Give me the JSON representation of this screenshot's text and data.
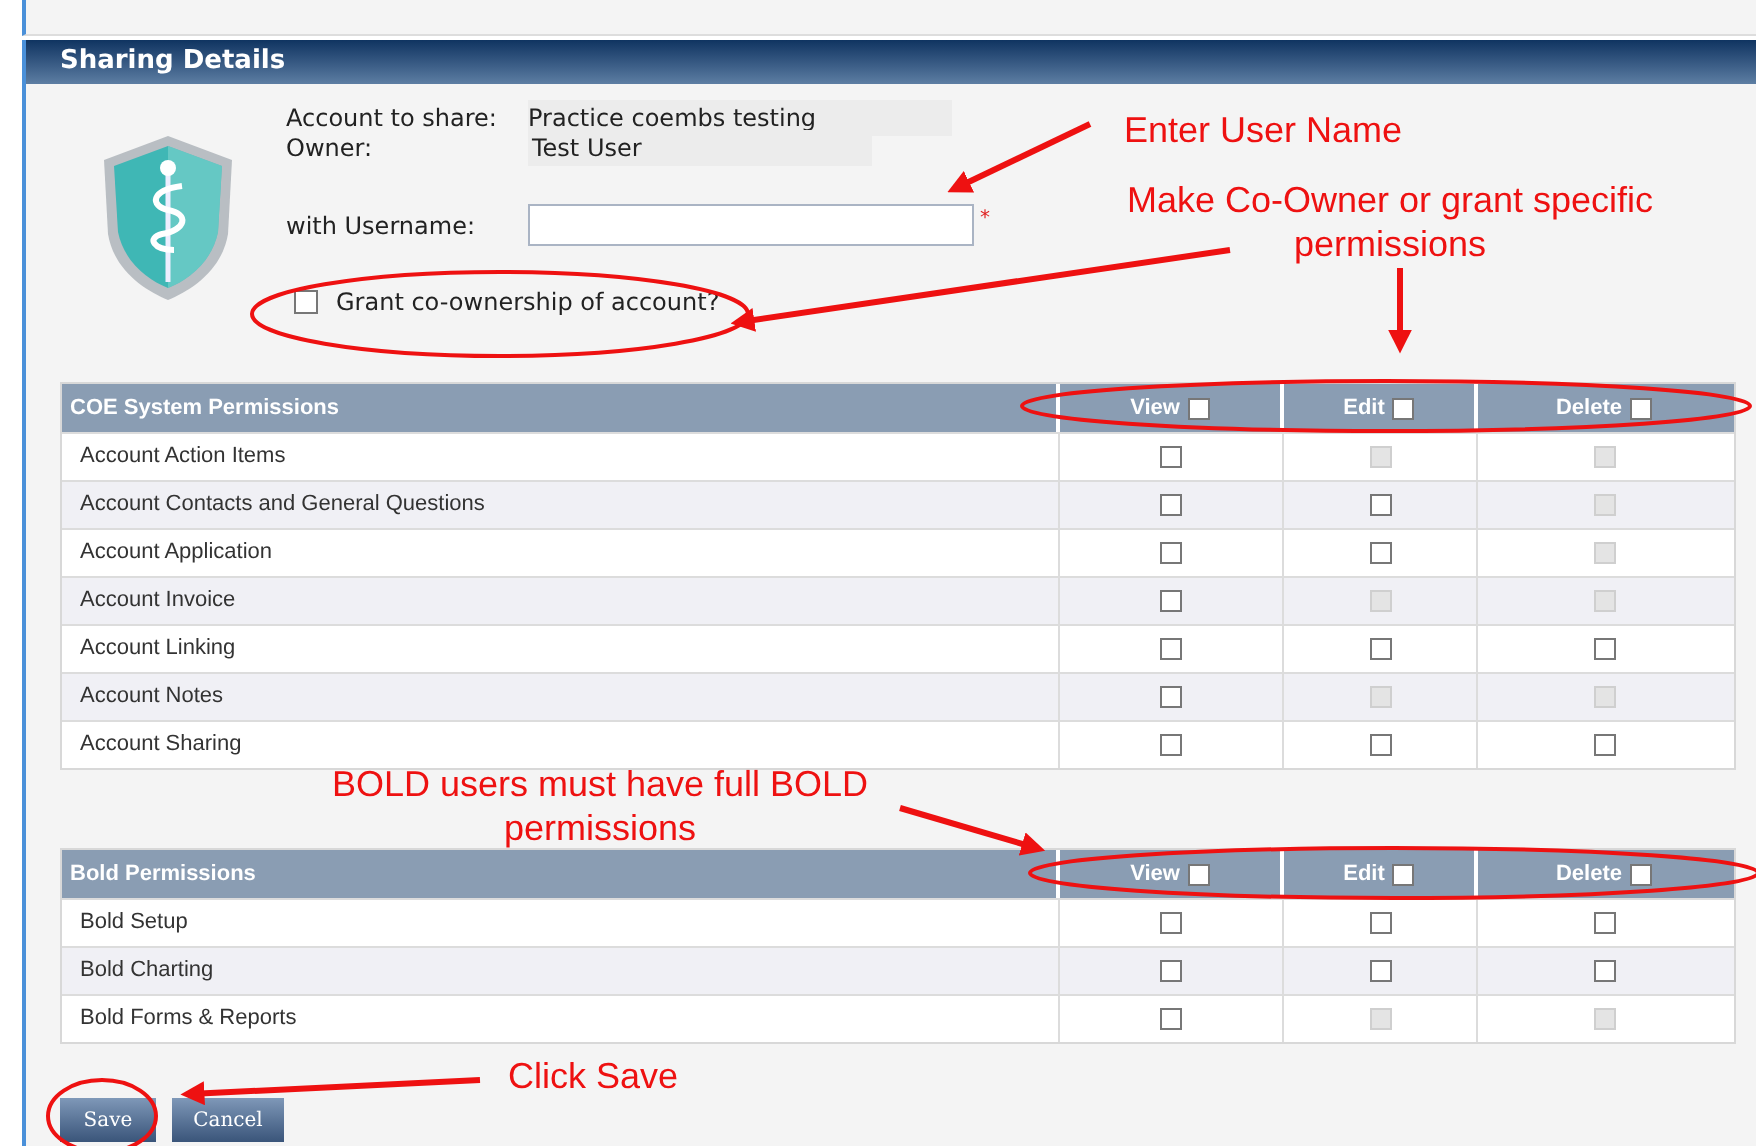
{
  "panel": {
    "title": "Sharing Details"
  },
  "account": {
    "fields": [
      {
        "label": "Account to share:",
        "value": "Practice coembs testing"
      },
      {
        "label": "Owner:",
        "value": "Test User"
      }
    ],
    "username": {
      "label": "with Username:",
      "required_mark": "*"
    },
    "co_ownership": {
      "label": "Grant co-ownership of account?",
      "checked": false
    }
  },
  "tables": [
    {
      "title": "COE System Permissions",
      "columns": [
        {
          "label": "View",
          "checked": false
        },
        {
          "label": "Edit",
          "checked": false
        },
        {
          "label": "Delete",
          "checked": false
        }
      ],
      "rows": [
        {
          "name": "Account Action Items",
          "permissions": [
            {
              "checked": false,
              "disabled": false
            },
            {
              "checked": false,
              "disabled": true
            },
            {
              "checked": false,
              "disabled": true
            }
          ]
        },
        {
          "name": "Account Contacts and General Questions",
          "permissions": [
            {
              "checked": false,
              "disabled": false
            },
            {
              "checked": false,
              "disabled": false
            },
            {
              "checked": false,
              "disabled": true
            }
          ]
        },
        {
          "name": "Account Application",
          "permissions": [
            {
              "checked": false,
              "disabled": false
            },
            {
              "checked": false,
              "disabled": false
            },
            {
              "checked": false,
              "disabled": true
            }
          ]
        },
        {
          "name": "Account Invoice",
          "permissions": [
            {
              "checked": false,
              "disabled": false
            },
            {
              "checked": false,
              "disabled": true
            },
            {
              "checked": false,
              "disabled": true
            }
          ]
        },
        {
          "name": "Account Linking",
          "permissions": [
            {
              "checked": false,
              "disabled": false
            },
            {
              "checked": false,
              "disabled": false
            },
            {
              "checked": false,
              "disabled": false
            }
          ]
        },
        {
          "name": "Account Notes",
          "permissions": [
            {
              "checked": false,
              "disabled": false
            },
            {
              "checked": false,
              "disabled": true
            },
            {
              "checked": false,
              "disabled": true
            }
          ]
        },
        {
          "name": "Account Sharing",
          "permissions": [
            {
              "checked": false,
              "disabled": false
            },
            {
              "checked": false,
              "disabled": false
            },
            {
              "checked": false,
              "disabled": false
            }
          ]
        }
      ]
    },
    {
      "title": "Bold Permissions",
      "columns": [
        {
          "label": "View",
          "checked": false
        },
        {
          "label": "Edit",
          "checked": false
        },
        {
          "label": "Delete",
          "checked": false
        }
      ],
      "rows": [
        {
          "name": "Bold Setup",
          "permissions": [
            {
              "checked": false,
              "disabled": false
            },
            {
              "checked": false,
              "disabled": false
            },
            {
              "checked": false,
              "disabled": false
            }
          ]
        },
        {
          "name": "Bold Charting",
          "permissions": [
            {
              "checked": false,
              "disabled": false
            },
            {
              "checked": false,
              "disabled": false
            },
            {
              "checked": false,
              "disabled": false
            }
          ]
        },
        {
          "name": "Bold Forms & Reports",
          "permissions": [
            {
              "checked": false,
              "disabled": false
            },
            {
              "checked": false,
              "disabled": true
            },
            {
              "checked": false,
              "disabled": true
            }
          ]
        }
      ]
    }
  ],
  "buttons": [
    {
      "label": "Save"
    },
    {
      "label": "Cancel"
    }
  ],
  "annotations": [
    "Enter User Name",
    "Make Co-Owner or grant specific permissions",
    "BOLD users must have full BOLD permissions",
    "Click Save"
  ]
}
